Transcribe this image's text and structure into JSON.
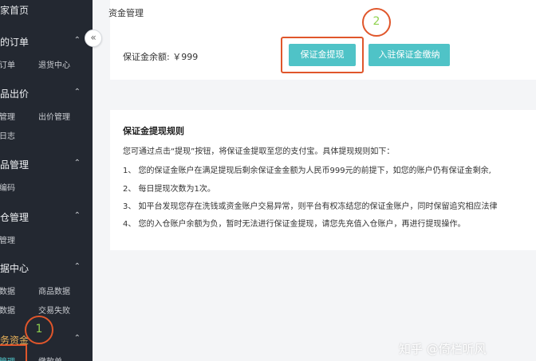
{
  "sidebar": {
    "home": "商家首页",
    "sections": [
      {
        "title": "我的订单",
        "subs": [
          "订单",
          "退货中心"
        ]
      },
      {
        "title": "商品出价",
        "subs": [
          "管理",
          "出价管理",
          "日志"
        ]
      },
      {
        "title": "商品管理",
        "subs": [
          "编码"
        ]
      },
      {
        "title": "入仓管理",
        "subs": [
          "管理"
        ]
      },
      {
        "title": "数据中心",
        "subs": [
          "数据",
          "商品数据",
          "数据",
          "交易失败"
        ]
      },
      {
        "title": "财务资金",
        "subs": [
          "管理",
          "缴款单"
        ]
      }
    ],
    "collapse_icon": "«"
  },
  "annotations": {
    "step1": "1",
    "step2": "2"
  },
  "main": {
    "title": "资金管理",
    "balance_label": "保证金余额: ￥999",
    "withdraw_button": "保证金提现",
    "pay_button": "入驻保证金缴纳"
  },
  "rules": {
    "title": "保证金提现规则",
    "intro": "您可通过点击“提现”按钮，将保证金提取至您的支付宝。具体提现规则如下：",
    "items": [
      "1、 您的保证金账户在满足提现后剩余保证金金额为人民币999元的前提下，如您的账户仍有保证金剩余,",
      "2、 每日提现次数为1次。",
      "3、 如平台发现您存在洗钱或资金账户交易异常，则平台有权冻结您的保证金账户，同时保留追究相应法律",
      "4、 您的入仓账户余额为负，暂时无法进行保证金提现，请您先充值入仓账户，再进行提现操作。"
    ]
  },
  "watermark": "知乎 @倚栏听风",
  "colors": {
    "sidebar_bg": "#232831",
    "accent": "#4fc3c7",
    "annotation": "#e0562b"
  }
}
